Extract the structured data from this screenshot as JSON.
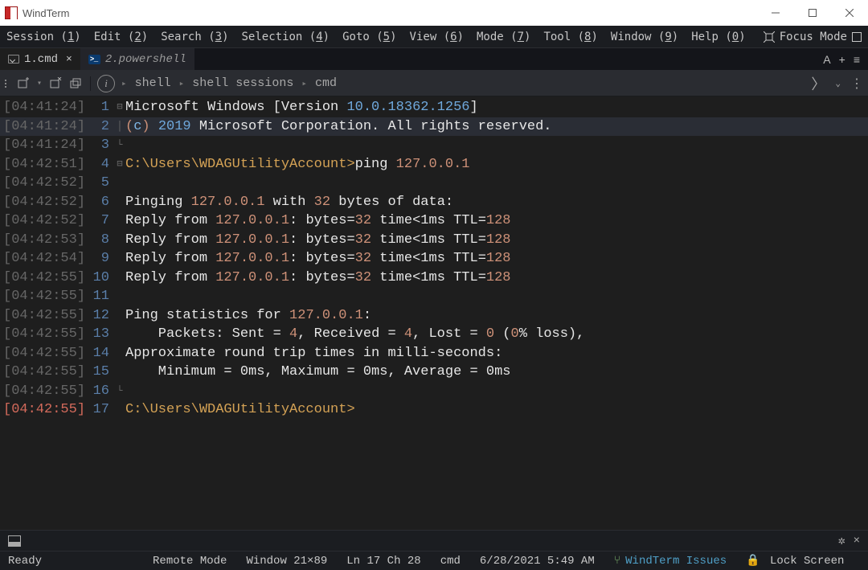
{
  "title": "WindTerm",
  "menu": {
    "session": "Session (1)",
    "edit": "Edit (2)",
    "search": "Search (3)",
    "selection": "Selection (4)",
    "goto": "Goto (5)",
    "view": "View (6)",
    "mode": "Mode (7)",
    "tool": "Tool (8)",
    "window": "Window (9)",
    "help": "Help (0)",
    "focus": "Focus Mode"
  },
  "tabs": {
    "active": "1.cmd",
    "inactive": "2.powershell",
    "right_a": "A",
    "right_plus": "+",
    "right_menu": "≡"
  },
  "toolbar": {
    "play": "▸",
    "bc1": "shell",
    "bc2": "shell sessions",
    "bc3": "cmd"
  },
  "lines": [
    {
      "ts": "[04:41:24]",
      "ln": "1",
      "gut": "⊟",
      "html": "<span class='c-cmd'>Microsoft Windows [Version </span><span class='c-ver'>10.0.18362.1256</span><span class='c-cmd'>]</span>"
    },
    {
      "ts": "[04:41:24]",
      "ln": "2",
      "gut": "│",
      "hl": true,
      "html": "<span class='c-punc'>(</span><span class='c-high'>c</span><span class='c-punc'>)</span> <span class='c-ver'>2019</span><span class='c-cmd'> Microsoft Corporation. All rights reserved.</span>"
    },
    {
      "ts": "[04:41:24]",
      "ln": "3",
      "gut": "└",
      "html": ""
    },
    {
      "ts": "[04:42:51]",
      "ln": "4",
      "gut": "⊟",
      "html": "<span class='c-prompt'>C:\\Users\\WDAGUtilityAccount&gt;</span><span class='c-cmd'>ping </span><span class='c-ip'>127.0.0.1</span>"
    },
    {
      "ts": "[04:42:52]",
      "ln": "5",
      "gut": "",
      "html": ""
    },
    {
      "ts": "[04:42:52]",
      "ln": "6",
      "gut": "",
      "html": "<span class='c-cmd'>Pinging </span><span class='c-ip'>127.0.0.1</span><span class='c-cmd'> with </span><span class='c-num'>32</span><span class='c-cmd'> bytes of data:</span>"
    },
    {
      "ts": "[04:42:52]",
      "ln": "7",
      "gut": "",
      "html": "<span class='c-cmd'>Reply from </span><span class='c-ip'>127.0.0.1</span><span class='c-cmd'>: bytes=</span><span class='c-num'>32</span><span class='c-cmd'> time&lt;1ms TTL=</span><span class='c-num'>128</span>"
    },
    {
      "ts": "[04:42:53]",
      "ln": "8",
      "gut": "",
      "html": "<span class='c-cmd'>Reply from </span><span class='c-ip'>127.0.0.1</span><span class='c-cmd'>: bytes=</span><span class='c-num'>32</span><span class='c-cmd'> time&lt;1ms TTL=</span><span class='c-num'>128</span>"
    },
    {
      "ts": "[04:42:54]",
      "ln": "9",
      "gut": "",
      "html": "<span class='c-cmd'>Reply from </span><span class='c-ip'>127.0.0.1</span><span class='c-cmd'>: bytes=</span><span class='c-num'>32</span><span class='c-cmd'> time&lt;1ms TTL=</span><span class='c-num'>128</span>"
    },
    {
      "ts": "[04:42:55]",
      "ln": "10",
      "gut": "",
      "html": "<span class='c-cmd'>Reply from </span><span class='c-ip'>127.0.0.1</span><span class='c-cmd'>: bytes=</span><span class='c-num'>32</span><span class='c-cmd'> time&lt;1ms TTL=</span><span class='c-num'>128</span>"
    },
    {
      "ts": "[04:42:55]",
      "ln": "11",
      "gut": "",
      "html": ""
    },
    {
      "ts": "[04:42:55]",
      "ln": "12",
      "gut": "",
      "html": "<span class='c-cmd'>Ping statistics for </span><span class='c-ip'>127.0.0.1</span><span class='c-cmd'>:</span>"
    },
    {
      "ts": "[04:42:55]",
      "ln": "13",
      "gut": "",
      "html": "<span class='c-cmd'>    Packets: Sent = </span><span class='c-num'>4</span><span class='c-cmd'>, Received = </span><span class='c-num'>4</span><span class='c-cmd'>, Lost = </span><span class='c-num'>0</span><span class='c-cmd'> (</span><span class='c-num'>0</span><span class='c-cmd'>% loss),</span>"
    },
    {
      "ts": "[04:42:55]",
      "ln": "14",
      "gut": "",
      "html": "<span class='c-cmd'>Approximate round trip times in milli-seconds:</span>"
    },
    {
      "ts": "[04:42:55]",
      "ln": "15",
      "gut": "",
      "html": "<span class='c-cmd'>    Minimum = 0ms, Maximum = 0ms, Average = 0ms</span>"
    },
    {
      "ts": "[04:42:55]",
      "ln": "16",
      "gut": "└",
      "html": ""
    },
    {
      "ts": "[04:42:55]",
      "ln": "17",
      "gut": "",
      "curr": true,
      "html": "<span class='c-prompt'>C:\\Users\\WDAGUtilityAccount&gt;</span>"
    }
  ],
  "status": {
    "ready": "Ready",
    "remote": "Remote Mode",
    "window": "Window 21×89",
    "pos": "Ln 17 Ch 28",
    "shell": "cmd",
    "date": "6/28/2021 5:49 AM",
    "issues": "WindTerm Issues",
    "lock": "Lock Screen"
  }
}
